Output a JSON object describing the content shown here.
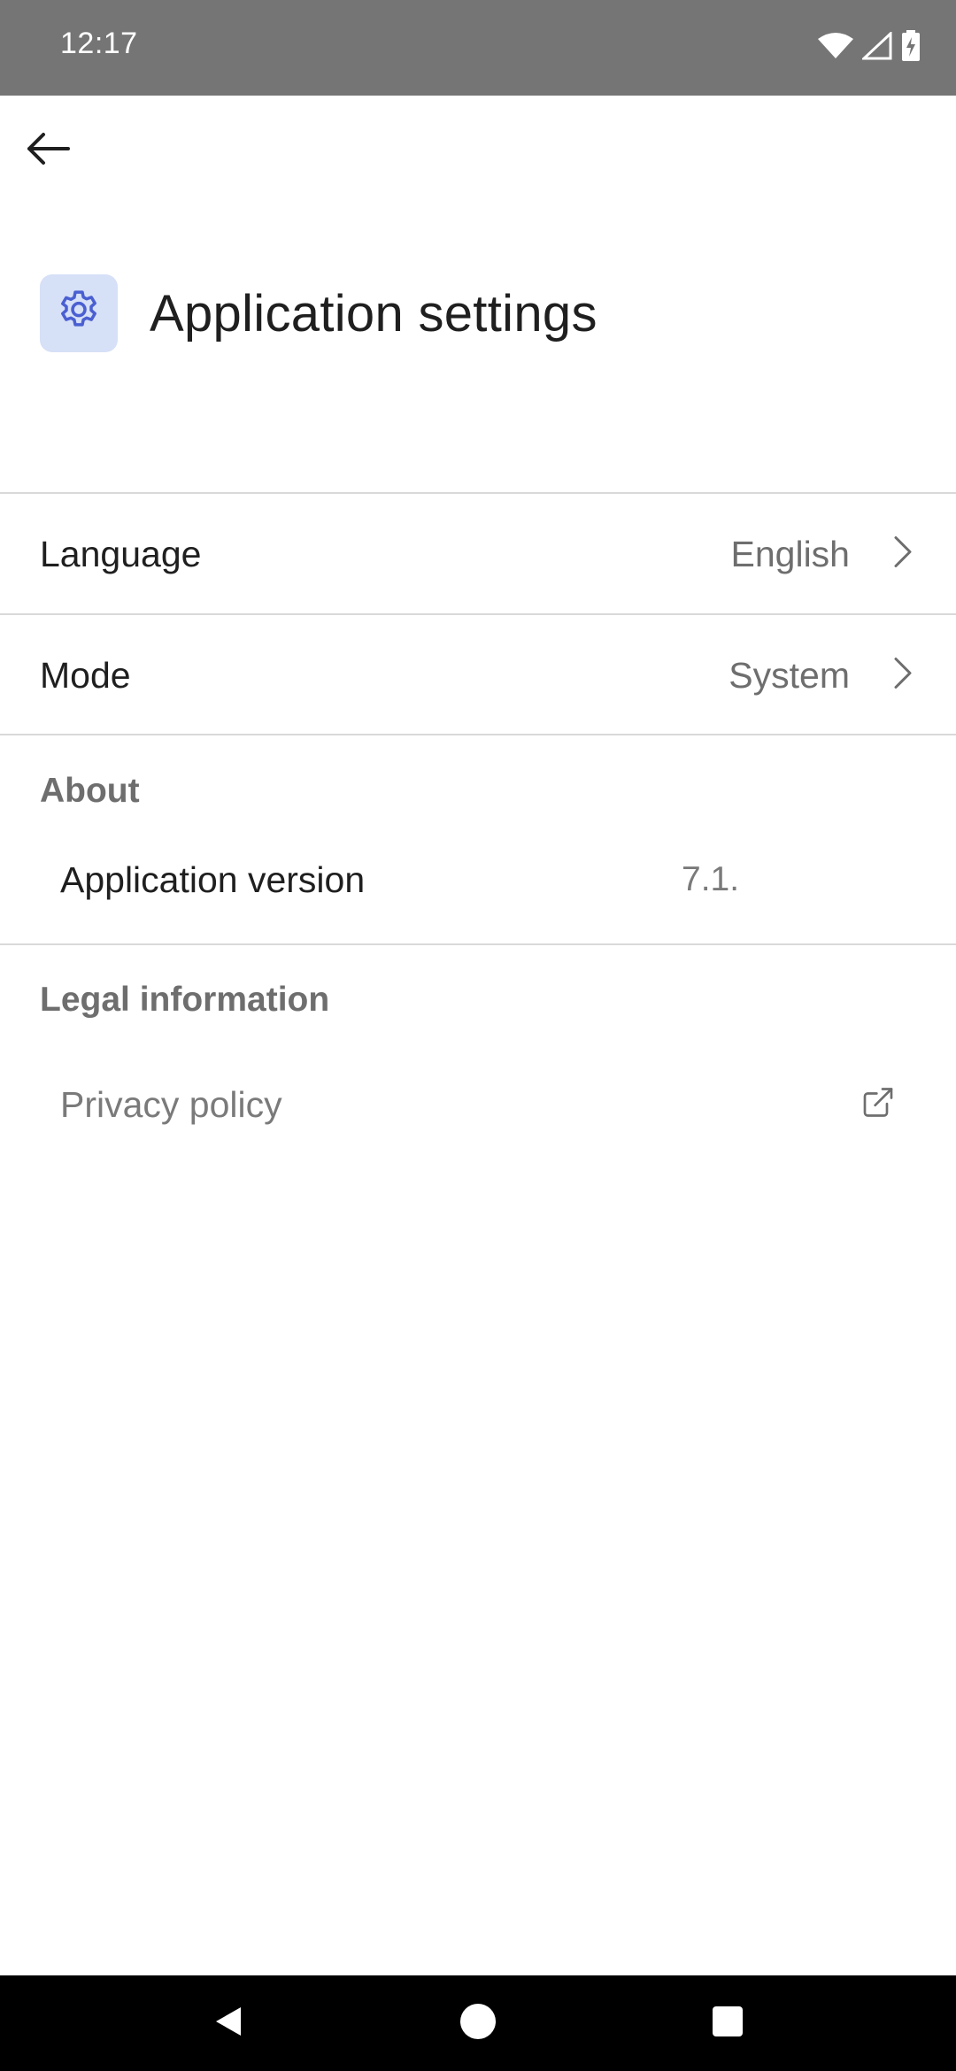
{
  "status_bar": {
    "time": "12:17",
    "icons": [
      "wifi-icon",
      "cell-signal-icon",
      "battery-charging-icon"
    ]
  },
  "app_bar": {
    "back_icon": "arrow-left-icon"
  },
  "header": {
    "icon": "gear-icon",
    "title": "Application settings",
    "icon_tile_color": "#d6e0f7",
    "icon_color": "#4a5fd1"
  },
  "settings": {
    "language": {
      "label": "Language",
      "value": "English",
      "icon": "chevron-right-icon"
    },
    "mode": {
      "label": "Mode",
      "value": "System",
      "icon": "chevron-right-icon"
    }
  },
  "about": {
    "section_title": "About",
    "version_label": "Application version",
    "version_value": "7.1."
  },
  "legal": {
    "section_title": "Legal information",
    "privacy_label": "Privacy policy",
    "privacy_icon": "external-link-icon"
  },
  "nav_bar": {
    "icons": [
      "nav-back-icon",
      "nav-home-icon",
      "nav-recents-icon"
    ]
  }
}
